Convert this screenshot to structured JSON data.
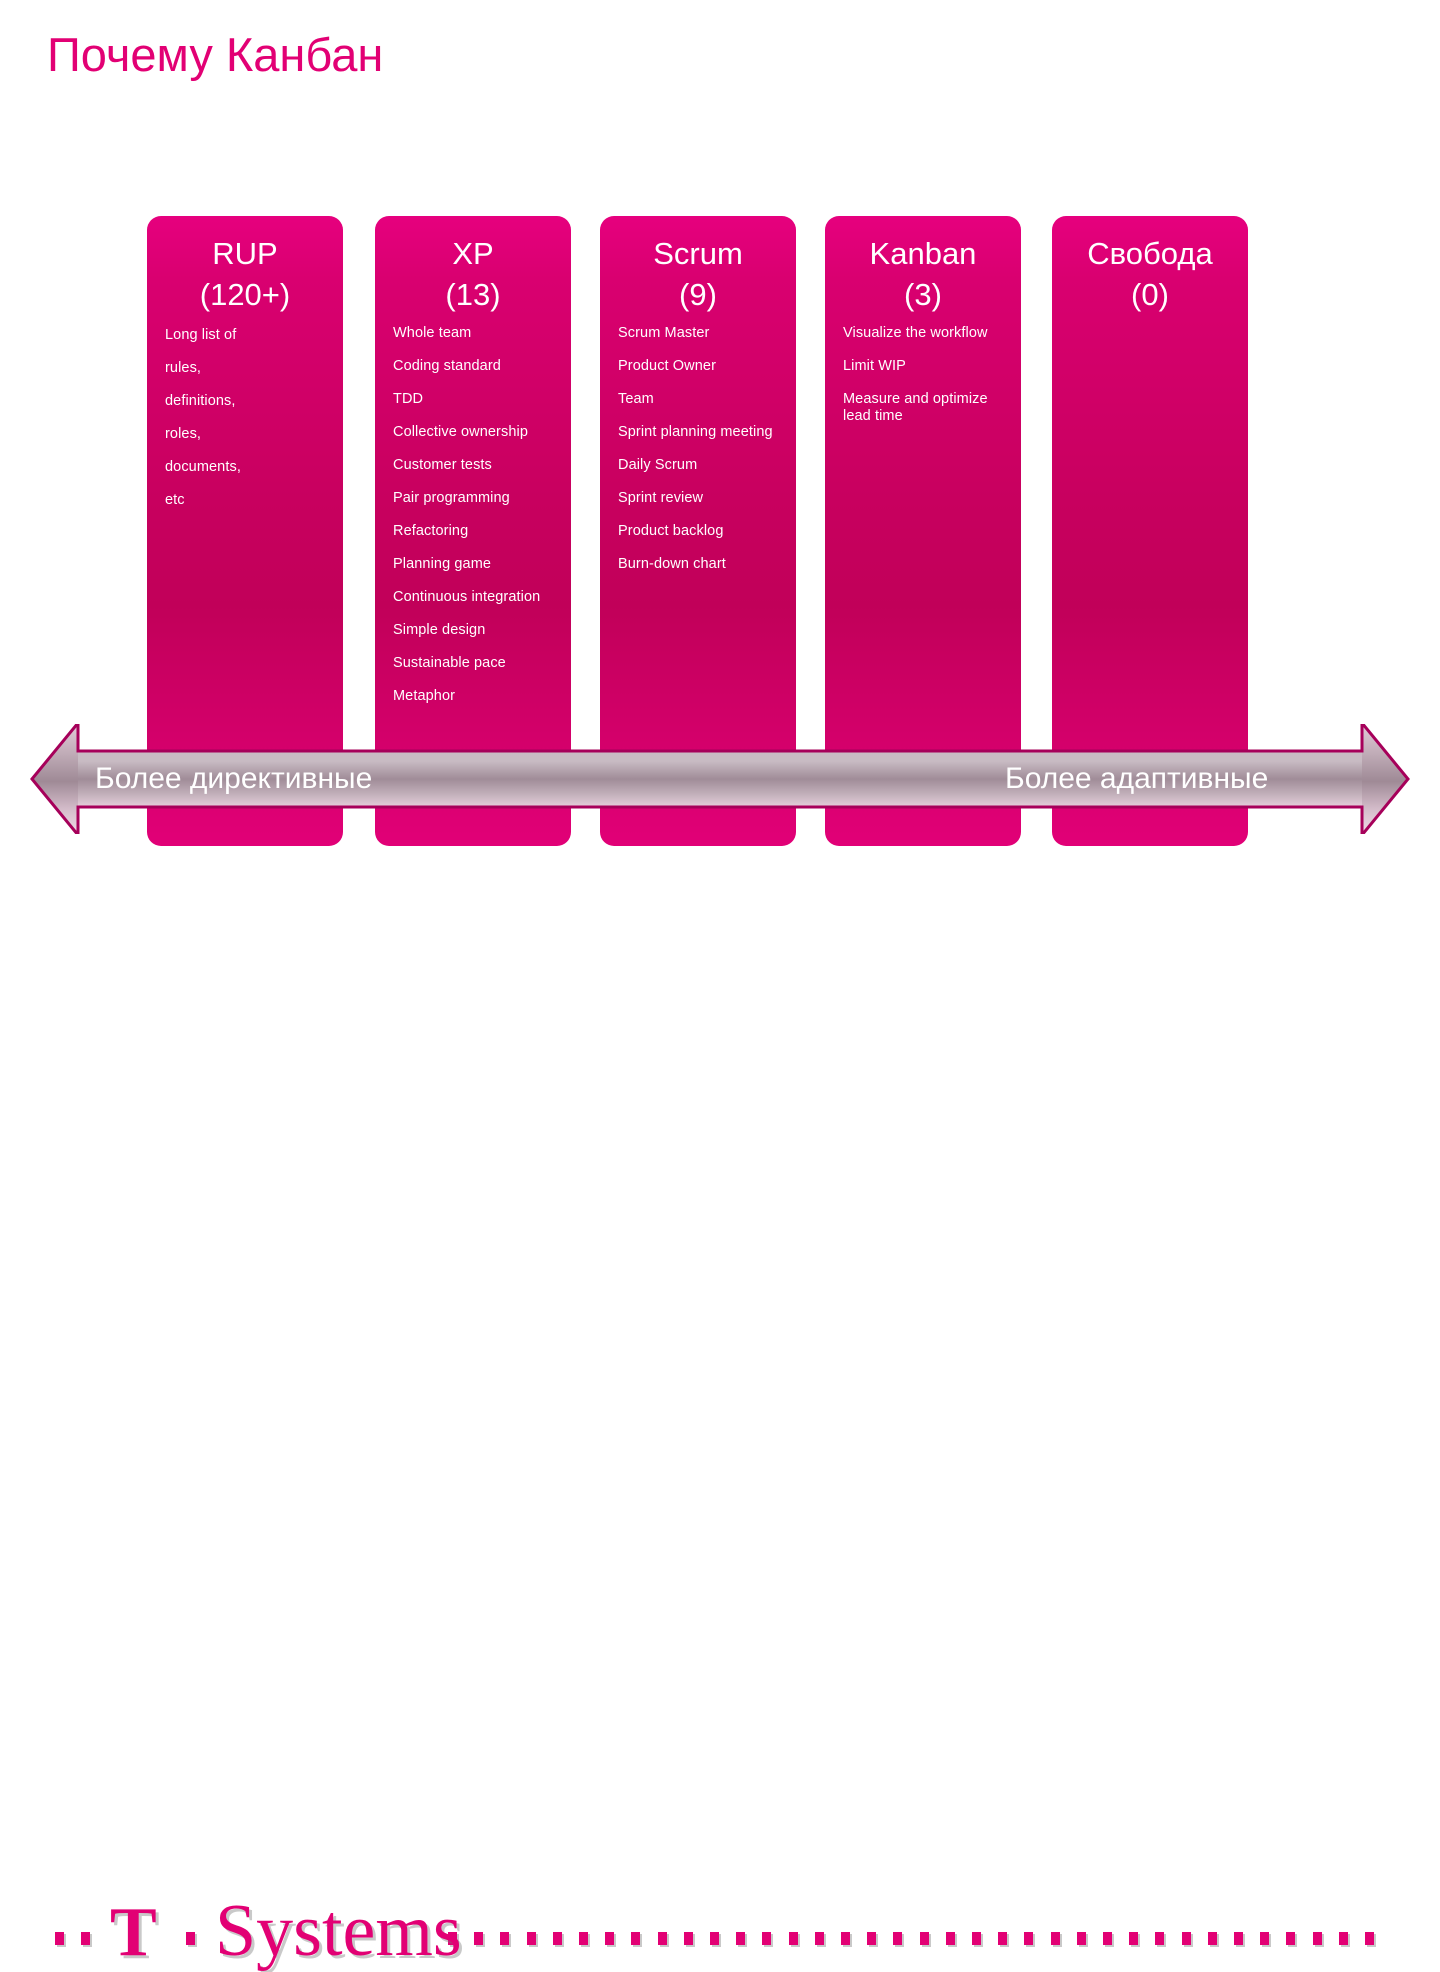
{
  "slide": {
    "title": "Почему Канбан",
    "accent_color": "#E20074",
    "column_color": "#C8005F",
    "text_color": "#FFFFFF"
  },
  "columns": [
    {
      "name": "RUP",
      "count": "(120+)",
      "items": [
        "Long list of",
        "rules,",
        "definitions,",
        "roles,",
        "documents,",
        "etc"
      ]
    },
    {
      "name": "XP",
      "count": "(13)",
      "items": [
        "Whole team",
        "Coding standard",
        "TDD",
        "Collective ownership",
        "Customer tests",
        "Pair programming",
        "Refactoring",
        "Planning game",
        "Continuous integration",
        "Simple design",
        "Sustainable pace",
        "Metaphor"
      ]
    },
    {
      "name": "Scrum",
      "count": "(9)",
      "items": [
        "Scrum Master",
        "Product Owner",
        "Team",
        "Sprint planning meeting",
        "Daily Scrum",
        "Sprint review",
        "Product backlog",
        "Burn-down chart"
      ]
    },
    {
      "name": "Kanban",
      "count": "(3)",
      "items": [
        "Visualize the workflow",
        "Limit WIP",
        "Measure and optimize lead time"
      ]
    },
    {
      "name": "Свобода",
      "count": "(0)",
      "items": []
    }
  ],
  "arrow": {
    "left_label": "Более директивные",
    "right_label": "Более адаптивные",
    "outline_color": "#A6005A"
  },
  "footer": {
    "logo_t": "T",
    "logo_systems": "Systems"
  }
}
